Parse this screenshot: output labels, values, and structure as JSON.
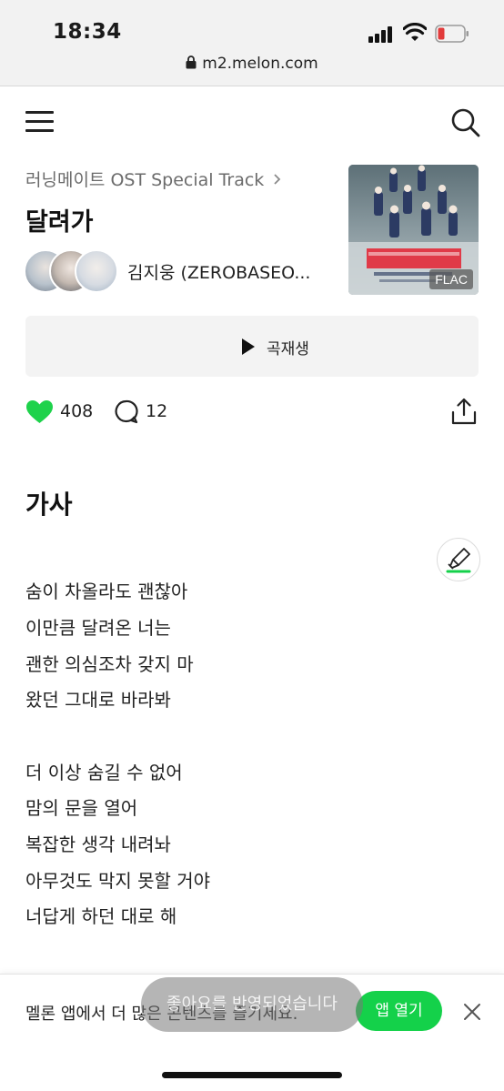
{
  "status_bar": {
    "time": "18:34"
  },
  "browser": {
    "url": "m2.melon.com"
  },
  "song": {
    "album": "러닝메이트 OST Special Track",
    "title": "달려가",
    "artist": "김지웅 (ZEROBASEO...",
    "quality_badge": "FLAC",
    "play_label": "곡재생",
    "likes": "408",
    "comments": "12"
  },
  "lyrics": {
    "heading": "가사",
    "lines": [
      "숨이 차올라도 괜찮아",
      "이만큼 달려온 너는",
      "괜한 의심조차 갖지 마",
      "왔던 그대로 바라봐",
      "더 이상 숨길 수 없어",
      "맘의 문을 열어",
      "복잡한 생각 내려놔",
      "아무것도 막지 못할 거야",
      "너답게 하던 대로 해"
    ]
  },
  "banner": {
    "text": "멜론 앱에서 더 많은 콘텐츠를 즐기세요.",
    "open_app_label": "앱 열기",
    "toast": "좋아요를 반영되었습니다"
  },
  "colors": {
    "accent_green": "#14d14a",
    "heart_green": "#1ed24b"
  },
  "icons": [
    "menu-icon",
    "search-icon",
    "chevron-right-icon",
    "play-icon",
    "heart-icon",
    "comment-icon",
    "share-icon",
    "highlighter-icon",
    "close-icon",
    "lock-icon",
    "signal-icon",
    "wifi-icon",
    "battery-icon"
  ]
}
